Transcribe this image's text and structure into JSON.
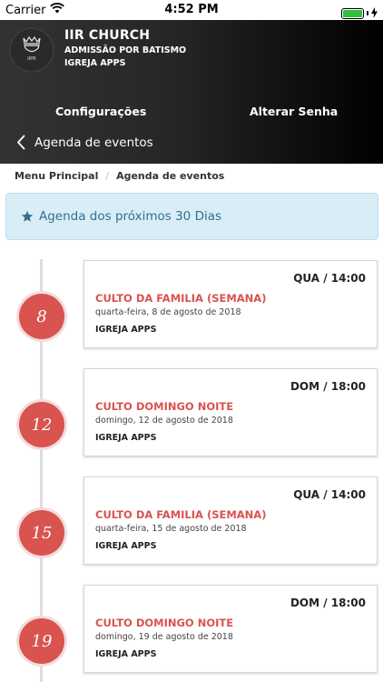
{
  "status_bar": {
    "carrier": "Carrier",
    "time": "4:52 PM"
  },
  "header": {
    "logo_text": "IIPR",
    "title": "IIR CHURCH",
    "subtitle": "ADMISSÃO POR BATISMO",
    "org": "IGREJA APPS",
    "config_label": "Configurações",
    "password_label": "Alterar Senha",
    "back_label": "Agenda de eventos"
  },
  "breadcrumb": {
    "home": "Menu Principal",
    "separator": "/",
    "current": "Agenda de eventos"
  },
  "alert": {
    "text": "Agenda dos próximos 30 Dias",
    "icon": "star-icon"
  },
  "colors": {
    "accent": "#d9534f",
    "alert_bg": "#d9edf7",
    "alert_text": "#31708f",
    "battery": "#2fbf3f"
  },
  "events": [
    {
      "day": "8",
      "day_time": "QUA / 14:00",
      "title": "CULTO DA FAMILIA (SEMANA)",
      "date": "quarta-feira, 8 de agosto de 2018",
      "org": "IGREJA APPS"
    },
    {
      "day": "12",
      "day_time": "DOM / 18:00",
      "title": "CULTO DOMINGO NOITE",
      "date": "domingo, 12 de agosto de 2018",
      "org": "IGREJA APPS"
    },
    {
      "day": "15",
      "day_time": "QUA / 14:00",
      "title": "CULTO DA FAMILIA (SEMANA)",
      "date": "quarta-feira, 15 de agosto de 2018",
      "org": "IGREJA APPS"
    },
    {
      "day": "19",
      "day_time": "DOM / 18:00",
      "title": "CULTO DOMINGO NOITE",
      "date": "domingo, 19 de agosto de 2018",
      "org": "IGREJA APPS"
    }
  ]
}
